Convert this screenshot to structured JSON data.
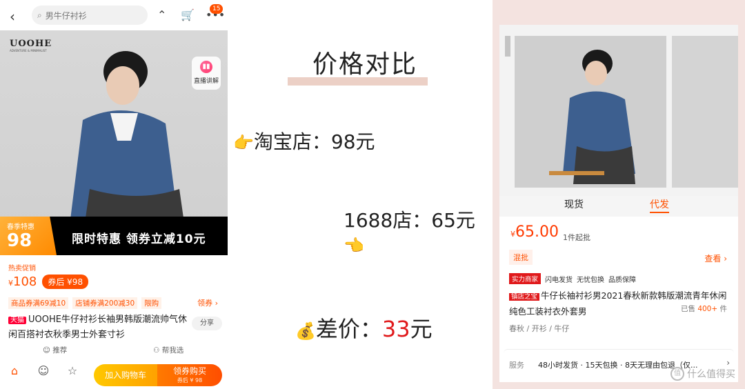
{
  "taobao": {
    "search_placeholder": "男牛仔衬衫",
    "cart_count": "15",
    "brand": "UOOHE",
    "brand_sub": "ADVENTURE & MINIMALIST",
    "live_label": "直播讲解",
    "spring_label": "春季特惠",
    "spring_price": "98",
    "banner_text": "限时特惠  领券立减10元",
    "hot_label": "热卖促销",
    "price_symbol": "¥",
    "price": "108",
    "after_coupon": "券后 ¥98",
    "coupon_tags": [
      "商品券满69减10",
      "店铺券满200减30",
      "限购"
    ],
    "coupon_link": "领券 ›",
    "tmall_tag": "天猫",
    "title": "UOOHE牛仔衬衫长袖男韩版潮流帅气休闲百搭衬衣秋季男士外套寸衫",
    "share_label": "分享",
    "recommend_label": "推荐",
    "help_label": "帮我选",
    "add_cart_label": "加入购物车",
    "buy_label": "领券购买",
    "buy_sub": "券后 ¥ 98",
    "nav_icons": [
      "store-icon",
      "service-icon",
      "favorite-icon"
    ]
  },
  "comparison": {
    "title": "价格对比",
    "taobao_line": "淘宝店：98元",
    "ali_line": "1688店：65元",
    "diff_prefix": "差价：",
    "diff_value": "33",
    "diff_suffix": "元",
    "point_right_emoji": "👈",
    "money_emoji": "💰"
  },
  "ali1688": {
    "tab_spot": "现货",
    "tab_dropship": "代发",
    "price_symbol": "¥",
    "price": "65.00",
    "moq": "1件起批",
    "mixed_label": "混批",
    "view_label": "查看 ›",
    "strong_merchant": "实力商家",
    "badges": [
      "闪电发货",
      "无忧包换",
      "品质保障"
    ],
    "shop_tag": "镇店之宝",
    "title": "牛仔长袖衬衫男2021春秋新款韩版潮流青年休闲纯色工装衬衣外套男",
    "sold_prefix": "已售",
    "sold_value": "400+",
    "sold_suffix": "件",
    "attrs": "春秋 / 开衫 / 牛仔",
    "service_label": "服务",
    "service_text": "48小时发货 · 15天包换 · 8天无理由包退（仅..."
  },
  "watermark": "什么值得买",
  "colors": {
    "taobao_orange": "#ff5000",
    "diff_red": "#e0191b",
    "right_bg": "#f4e3e0"
  }
}
